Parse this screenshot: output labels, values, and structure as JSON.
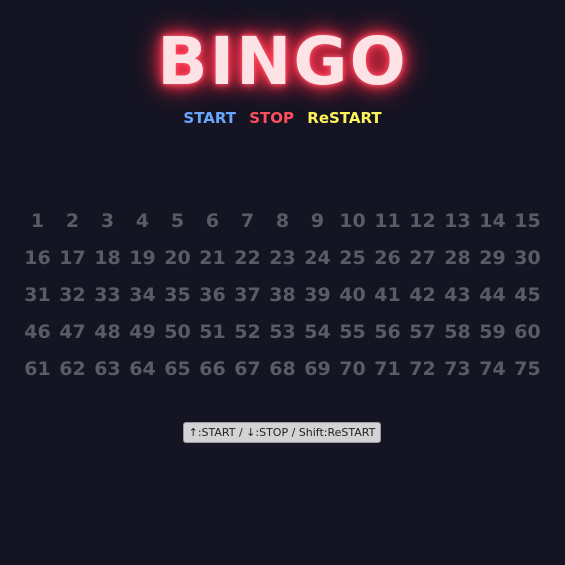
{
  "title": "BINGO",
  "controls": {
    "start": "START",
    "stop": "STOP",
    "restart": "ReSTART"
  },
  "colors": {
    "background": "#141423",
    "start": "#6aa6ff",
    "stop": "#ff4f5c",
    "restart": "#fff35a",
    "number_inactive": "#595b66"
  },
  "board": {
    "numbers": [
      "1",
      "2",
      "3",
      "4",
      "5",
      "6",
      "7",
      "8",
      "9",
      "10",
      "11",
      "12",
      "13",
      "14",
      "15",
      "16",
      "17",
      "18",
      "19",
      "20",
      "21",
      "22",
      "23",
      "24",
      "25",
      "26",
      "27",
      "28",
      "29",
      "30",
      "31",
      "32",
      "33",
      "34",
      "35",
      "36",
      "37",
      "38",
      "39",
      "40",
      "41",
      "42",
      "43",
      "44",
      "45",
      "46",
      "47",
      "48",
      "49",
      "50",
      "51",
      "52",
      "53",
      "54",
      "55",
      "56",
      "57",
      "58",
      "59",
      "60",
      "61",
      "62",
      "63",
      "64",
      "65",
      "66",
      "67",
      "68",
      "69",
      "70",
      "71",
      "72",
      "73",
      "74",
      "75"
    ]
  },
  "hint": "↑:START / ↓:STOP / Shift:ReSTART"
}
